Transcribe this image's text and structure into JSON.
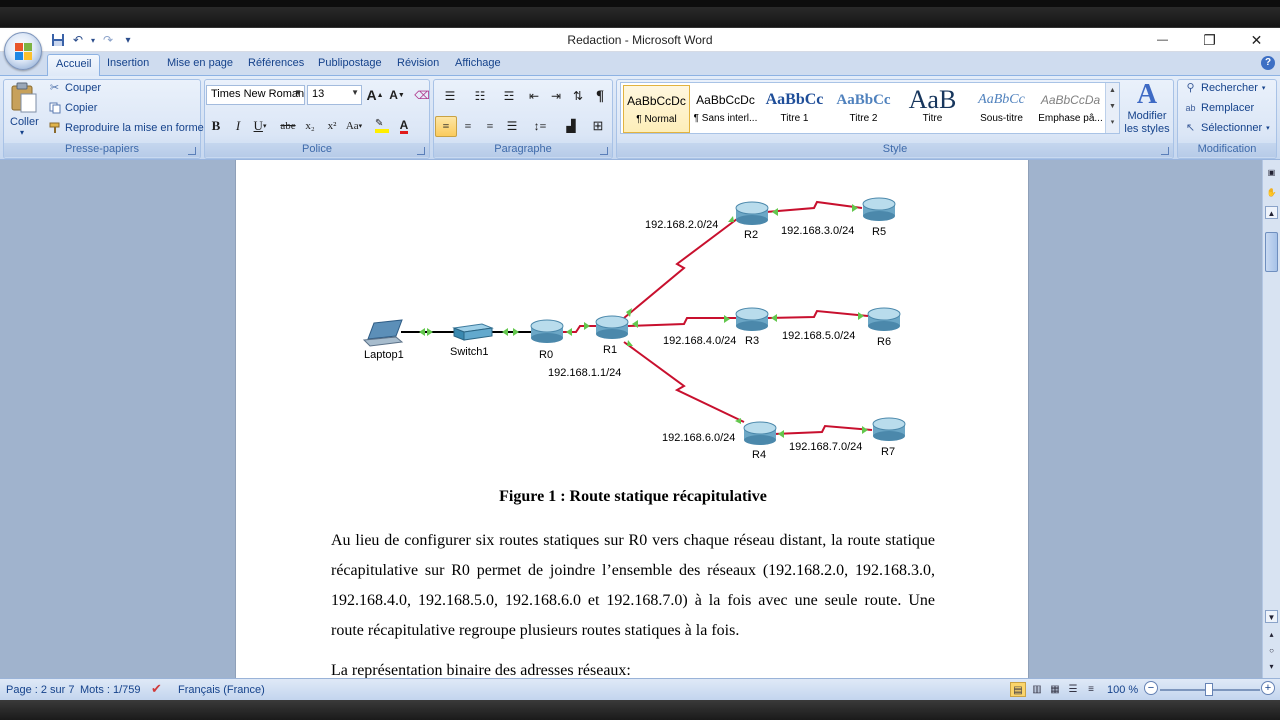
{
  "window": {
    "title": "Redaction - Microsoft Word",
    "minimize": "—",
    "restore": "❐",
    "close": "✕"
  },
  "qat": {
    "save_icon": "save-icon",
    "undo_icon": "undo-icon",
    "redo_icon": "redo-icon",
    "customize": "▾"
  },
  "tabs": [
    "Accueil",
    "Insertion",
    "Mise en page",
    "Références",
    "Publipostage",
    "Révision",
    "Affichage"
  ],
  "help": "?",
  "ribbon": {
    "clipboard": {
      "label": "Presse-papiers",
      "paste": "Coller",
      "cut": "Couper",
      "copy": "Copier",
      "format_painter": "Reproduire la mise en forme"
    },
    "font": {
      "label": "Police",
      "family": "Times New Roman",
      "size": "13",
      "grow": "A",
      "shrink": "A",
      "bold": "B",
      "italic": "I",
      "underline": "U",
      "strike": "abe",
      "subscript": "x₂",
      "superscript": "x²",
      "case": "Aa"
    },
    "paragraph": {
      "label": "Paragraphe",
      "pilcrow": "¶"
    },
    "styles": {
      "label": "Style",
      "items": [
        {
          "sample": "AaBbCcDc",
          "name": "¶ Normal"
        },
        {
          "sample": "AaBbCcDc",
          "name": "¶ Sans interl..."
        },
        {
          "sample": "AaBbCc",
          "name": "Titre 1"
        },
        {
          "sample": "AaBbCc",
          "name": "Titre 2"
        },
        {
          "sample": "AaB",
          "name": "Titre"
        },
        {
          "sample": "AaBbCc",
          "name": "Sous-titre"
        },
        {
          "sample": "AaBbCcDa",
          "name": "Emphase pâ..."
        }
      ],
      "change_styles": "Modifier les styles"
    },
    "editing": {
      "label": "Modification",
      "find": "Rechercher",
      "replace": "Remplacer",
      "select": "Sélectionner"
    }
  },
  "diagram": {
    "devices": {
      "laptop": "Laptop1",
      "switch": "Switch1",
      "r0": "R0",
      "r1": "R1",
      "r2": "R2",
      "r3": "R3",
      "r4": "R4",
      "r5": "R5",
      "r6": "R6",
      "r7": "R7"
    },
    "networks": {
      "n1": "192.168.1.1/24",
      "n2": "192.168.2.0/24",
      "n3": "192.168.3.0/24",
      "n4": "192.168.4.0/24",
      "n5": "192.168.5.0/24",
      "n6": "192.168.6.0/24",
      "n7": "192.168.7.0/24"
    },
    "link_color": "#c8102e"
  },
  "document": {
    "caption": "Figure 1 : Route statique récapitulative",
    "paragraph": "Au lieu de configurer six routes statiques sur R0 vers chaque réseau distant, la route statique récapitulative sur R0 permet de joindre l’ensemble des réseaux (192.168.2.0, 192.168.3.0, 192.168.4.0, 192.168.5.0, 192.168.6.0 et 192.168.7.0) à la fois avec une seule route. Une route récapitulative regroupe plusieurs routes statiques à la fois.",
    "paragraph2": "La représentation binaire des adresses réseaux:"
  },
  "status": {
    "page": "Page : 2 sur 7",
    "words": "Mots : 1/759",
    "language": "Français (France)",
    "zoom": "100 %",
    "zoom_out": "−",
    "zoom_in": "+"
  }
}
